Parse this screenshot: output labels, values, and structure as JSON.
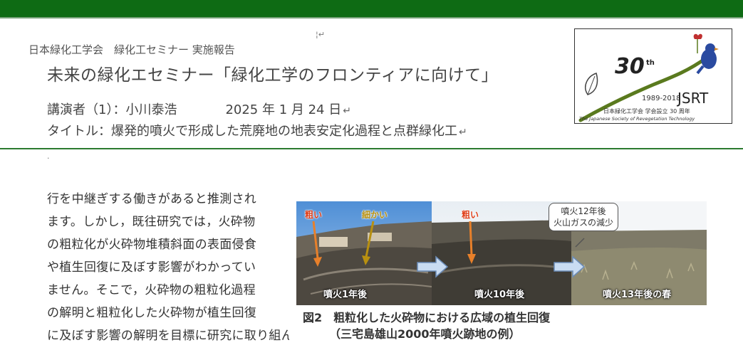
{
  "header": {
    "org_seminar": "日本緑化工学会　緑化工セミナー 実施報告",
    "title": "未来の緑化エセミナー「緑化工学のフロンティアに向けて」",
    "lecturer": "講演者（1）：小川泰浩",
    "date": "2025 年 1 月 24 日",
    "talk_title": "タイトル：爆発的噴火で形成した荒廃地の地表安定化過程と点群緑化工",
    "return_mark": "↵"
  },
  "logo": {
    "number": "30",
    "suffix": "th",
    "years": "1989-2018",
    "acronym": "JSRT",
    "jp_name": "日本緑化工学会 学会設立 30 周年",
    "en_name": "The Japanese Society of Revegetation Technology"
  },
  "body": {
    "lines": [
      "行を中継ぎする働きがあると推測され",
      "ます。しかし，既往研究では，火砕物",
      "の粗粒化が火砕物堆積斜面の表面侵食",
      "や植生回復に及ぼす影響がわかってい",
      "ません。そこで，火砕物の粗粒化過程",
      "の解明と粗粒化した火砕物が植生回復",
      "に及ぼす影響の解明を目標に研究に取り組んでいます"
    ]
  },
  "figure": {
    "arrow_coarse_1": "粗い",
    "arrow_fine": "細かい",
    "arrow_coarse_2": "粗い",
    "callout_line1": "噴火12年後",
    "callout_line2": "火山ガスの減少",
    "panel1_label": "噴火1年後",
    "panel2_label": "噴火10年後",
    "panel3_label": "噴火13年後の春",
    "caption_line1": "図2　粗粒化した火砕物における広域の植生回復",
    "caption_line2": "（三宅島雄山2000年噴火跡地の例）"
  },
  "colors": {
    "top_bar": "#0e6b14",
    "divider": "#2c7a2f",
    "arrow_orange": "#e8802a",
    "arrow_olive": "#b89010",
    "label_red": "#e0401a"
  }
}
